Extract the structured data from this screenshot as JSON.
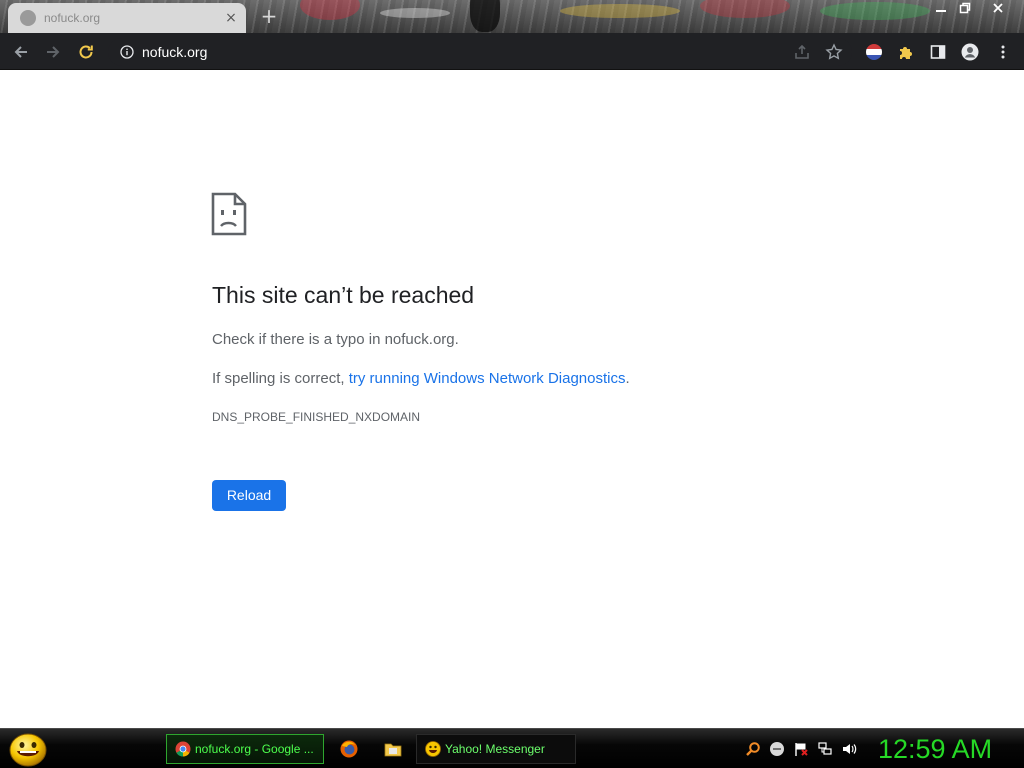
{
  "browser": {
    "tab": {
      "title": "nofuck.org",
      "close_label": "×"
    },
    "new_tab_label": "+",
    "address_bar": {
      "url": "nofuck.org"
    }
  },
  "error_page": {
    "title": "This site can’t be reached",
    "line1": "Check if there is a typo in nofuck.org.",
    "line2_prefix": "If spelling is correct, ",
    "line2_link": "try running Windows Network Diagnostics",
    "line2_suffix": ".",
    "error_code": "DNS_PROBE_FINISHED_NXDOMAIN",
    "reload_label": "Reload"
  },
  "taskbar": {
    "tasks": [
      {
        "label": "nofuck.org - Google ...",
        "icon": "chrome-icon"
      },
      {
        "label": "Yahoo! Messenger",
        "icon": "yahoo-messenger-icon"
      }
    ],
    "quick_launch": [
      "firefox-icon",
      "folder-icon"
    ],
    "tray": [
      "search-icon",
      "messenger-status-icon",
      "flag-icon",
      "network-icon",
      "volume-icon"
    ],
    "clock": "12:59 AM"
  },
  "colors": {
    "link": "#1a73e8",
    "button": "#1a73e8",
    "clock": "#26d926",
    "toolbar": "#202124"
  }
}
